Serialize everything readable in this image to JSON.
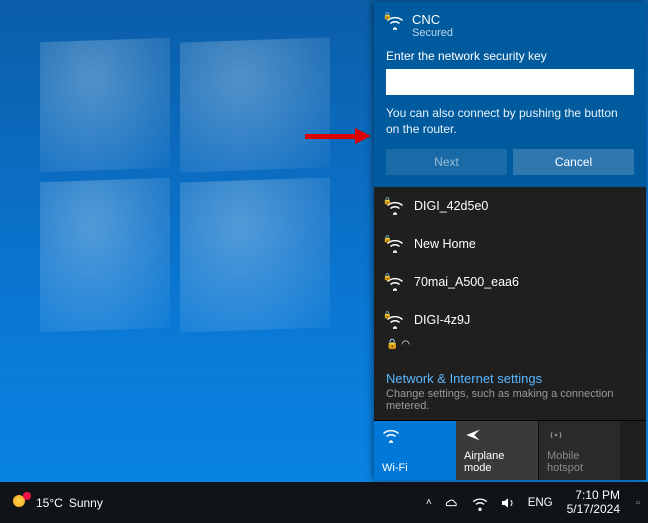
{
  "connect_panel": {
    "ssid": "CNC",
    "status": "Secured",
    "prompt": "Enter the network security key",
    "password_value": "",
    "hint": "You can also connect by pushing the button on the router.",
    "next_label": "Next",
    "cancel_label": "Cancel"
  },
  "networks": [
    {
      "ssid": "DIGI_42d5e0",
      "secured": true
    },
    {
      "ssid": "New Home",
      "secured": true
    },
    {
      "ssid": "70mai_A500_eaa6",
      "secured": true
    },
    {
      "ssid": "DIGI-4z9J",
      "secured": true
    }
  ],
  "settings_link": "Network & Internet settings",
  "settings_sub": "Change settings, such as making a connection metered.",
  "tiles": {
    "wifi": "Wi-Fi",
    "airplane": "Airplane mode",
    "hotspot": "Mobile hotspot"
  },
  "taskbar": {
    "temp": "15°C",
    "weather": "Sunny",
    "lang": "ENG",
    "time": "7:10 PM",
    "date": "5/17/2024"
  }
}
